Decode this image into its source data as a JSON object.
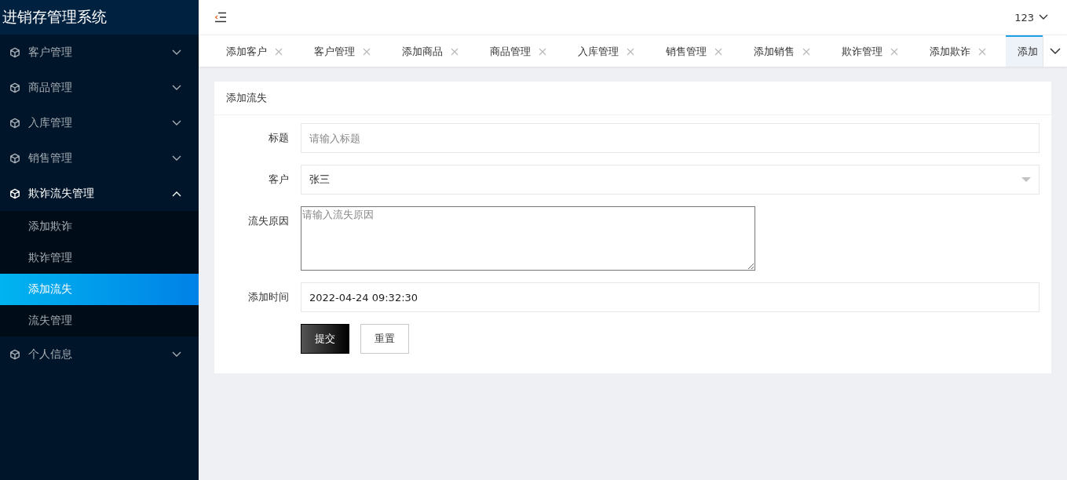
{
  "sidebar": {
    "title": "进销存管理系统",
    "menu": [
      {
        "label": "客户管理",
        "expanded": false
      },
      {
        "label": "商品管理",
        "expanded": false
      },
      {
        "label": "入库管理",
        "expanded": false
      },
      {
        "label": "销售管理",
        "expanded": false
      },
      {
        "label": "欺诈流失管理",
        "expanded": true,
        "children": [
          {
            "label": "添加欺诈",
            "selected": false
          },
          {
            "label": "欺诈管理",
            "selected": false
          },
          {
            "label": "添加流失",
            "selected": true
          },
          {
            "label": "流失管理",
            "selected": false
          }
        ]
      },
      {
        "label": "个人信息",
        "expanded": false
      }
    ]
  },
  "topbar": {
    "user": "123"
  },
  "tabs": [
    {
      "label": "添加客户",
      "selected": false
    },
    {
      "label": "客户管理",
      "selected": false
    },
    {
      "label": "添加商品",
      "selected": false
    },
    {
      "label": "商品管理",
      "selected": false
    },
    {
      "label": "入库管理",
      "selected": false
    },
    {
      "label": "销售管理",
      "selected": false
    },
    {
      "label": "添加销售",
      "selected": false
    },
    {
      "label": "欺诈管理",
      "selected": false
    },
    {
      "label": "添加欺诈",
      "selected": false
    },
    {
      "label": "添加",
      "selected": true
    }
  ],
  "form": {
    "title": "添加流失",
    "fields": [
      {
        "kind": "text",
        "label": "标题",
        "placeholder": "请输入标题"
      },
      {
        "kind": "select",
        "label": "客户",
        "value": "张三"
      },
      {
        "kind": "textarea",
        "label": "流失原因",
        "placeholder": "请输入流失原因"
      },
      {
        "kind": "text",
        "label": "添加时间",
        "value": "2022-04-24 09:32:30"
      }
    ],
    "buttons": [
      {
        "label": "提交",
        "kind": "primary"
      },
      {
        "label": "重置",
        "kind": "default"
      }
    ]
  }
}
